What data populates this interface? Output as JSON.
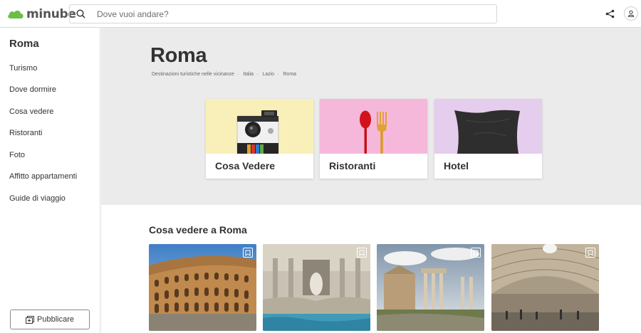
{
  "header": {
    "logo_text": "minube",
    "search_placeholder": "Dove vuoi andare?",
    "icons": [
      "search-icon",
      "share-icon",
      "user-icon"
    ]
  },
  "sidebar": {
    "title": "Roma",
    "items": [
      {
        "label": "Turismo"
      },
      {
        "label": "Dove dormire"
      },
      {
        "label": "Cosa vedere"
      },
      {
        "label": "Ristoranti"
      },
      {
        "label": "Foto"
      },
      {
        "label": "Affitto appartamenti"
      },
      {
        "label": "Guide di viaggio"
      }
    ],
    "publish_label": "Pubblicare"
  },
  "main": {
    "title": "Roma",
    "breadcrumbs": [
      "Destinazioni turistiche nelle vicinanze",
      "Italia",
      "Lazio",
      "Roma"
    ],
    "categories": [
      {
        "label": "Cosa Vedere",
        "bg": "#f8f0b8"
      },
      {
        "label": "Ristoranti",
        "bg": "#f5b8db"
      },
      {
        "label": "Hotel",
        "bg": "#e5cdee"
      }
    ],
    "section_title": "Cosa vedere a Roma",
    "places": [
      {
        "image": "colosseum"
      },
      {
        "image": "trevi-fountain"
      },
      {
        "image": "roman-forum"
      },
      {
        "image": "pantheon"
      }
    ]
  },
  "colors": {
    "brand_green": "#6cbe45",
    "background_gray": "#ebebeb",
    "text": "#333333"
  }
}
